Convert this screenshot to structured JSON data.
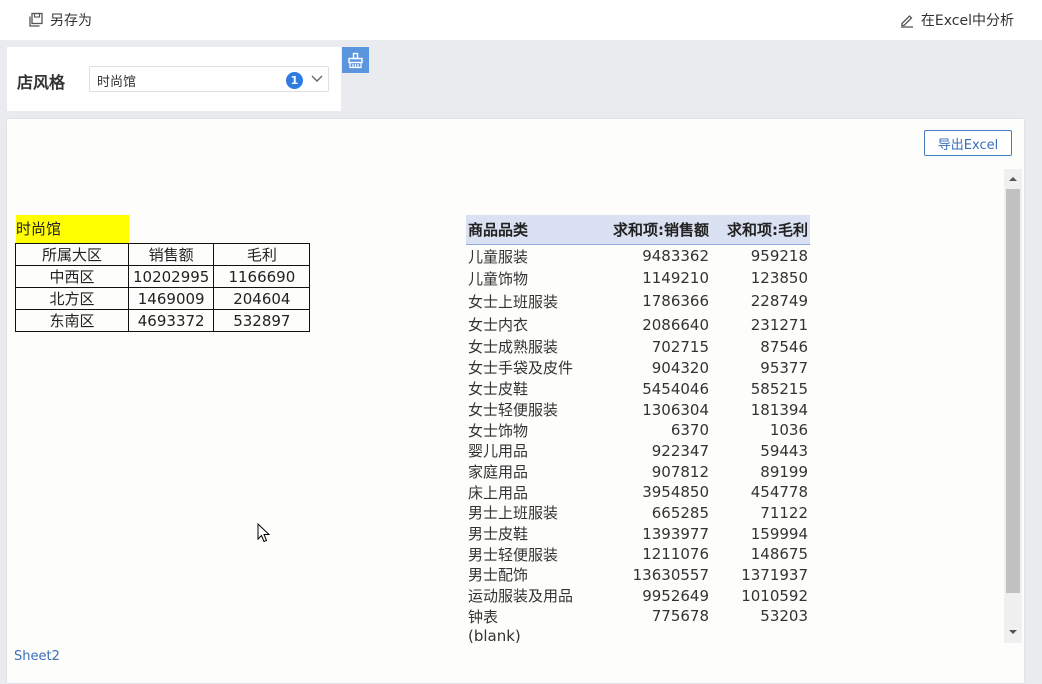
{
  "toolbar": {
    "save_as_label": "另存为",
    "analyze_in_excel_label": "在Excel中分析"
  },
  "filter": {
    "label": "店风格",
    "selected_value": "时尚馆",
    "selected_count": "1"
  },
  "report": {
    "export_label": "导出Excel",
    "shop_title": "时尚馆",
    "region_table": {
      "headers": [
        "所属大区",
        "销售额",
        "毛利"
      ],
      "rows": [
        [
          "中西区",
          "10202995",
          "1166690"
        ],
        [
          "北方区",
          "1469009",
          "204604"
        ],
        [
          "东南区",
          "4693372",
          "532897"
        ]
      ]
    },
    "pivot": {
      "headers": [
        "商品品类",
        "求和项:销售额",
        "求和项:毛利"
      ],
      "rows": [
        [
          "儿童服装",
          "9483362",
          "959218"
        ],
        [
          "儿童饰物",
          "1149210",
          "123850"
        ],
        [
          "女士上班服装",
          "1786366",
          "228749"
        ],
        [
          "女士内衣",
          "2086640",
          "231271"
        ],
        [
          "女士成熟服装",
          "702715",
          "87546"
        ],
        [
          "女士手袋及皮件",
          "904320",
          "95377"
        ],
        [
          "女士皮鞋",
          "5454046",
          "585215"
        ],
        [
          "女士轻便服装",
          "1306304",
          "181394"
        ],
        [
          "女士饰物",
          "6370",
          "1036"
        ],
        [
          "婴儿用品",
          "922347",
          "59443"
        ],
        [
          "家庭用品",
          "907812",
          "89199"
        ],
        [
          "床上用品",
          "3954850",
          "454778"
        ],
        [
          "男士上班服装",
          "665285",
          "71122"
        ],
        [
          "男士皮鞋",
          "1393977",
          "159994"
        ],
        [
          "男士轻便服装",
          "1211076",
          "148675"
        ],
        [
          "男士配饰",
          "13630557",
          "1371937"
        ],
        [
          "运动服装及用品",
          "9952649",
          "1010592"
        ],
        [
          "钟表",
          "775678",
          "53203"
        ],
        [
          "(blank)",
          "",
          ""
        ]
      ]
    },
    "sheet_tab": "Sheet2"
  },
  "colors": {
    "accent": "#2f7ce0",
    "shop_highlight": "#ffff00",
    "pivot_header_bg": "#d9e1f2"
  }
}
